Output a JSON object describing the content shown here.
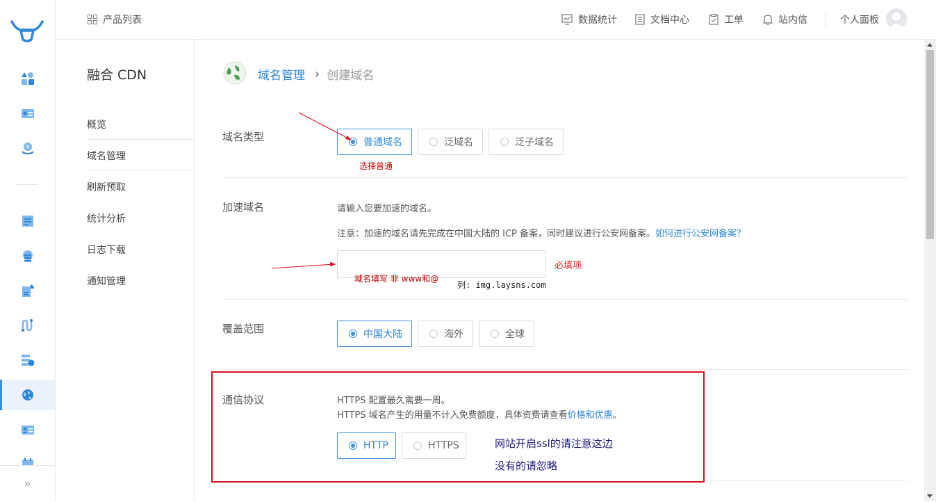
{
  "topbar": {
    "product_list": "产品列表",
    "stats": "数据统计",
    "docs": "文档中心",
    "ticket": "工单",
    "messages": "站内信",
    "panel": "个人面板"
  },
  "sidebar": {
    "title": "融合 CDN",
    "items": [
      "概览",
      "域名管理",
      "刷新预取",
      "统计分析",
      "日志下载",
      "通知管理"
    ]
  },
  "breadcrumb": {
    "parent": "域名管理",
    "separator": "›",
    "current": "创建域名"
  },
  "domain_type": {
    "label": "域名类型",
    "options": [
      "普通域名",
      "泛域名",
      "泛子域名"
    ],
    "selected": "普通域名",
    "annotation": "选择普通"
  },
  "accel_domain": {
    "label": "加速域名",
    "hint": "请输入您要加速的域名。",
    "notice": "注意：加速的域名请先完成在中国大陆的 ICP 备案，同时建议进行公安网备案。",
    "notice_link": "如何进行公安网备案？",
    "value": "",
    "required": "必填项",
    "annotation": "域名填写 非 www和@",
    "example": "列: img.laysns.com"
  },
  "coverage": {
    "label": "覆盖范围",
    "options": [
      "中国大陆",
      "海外",
      "全球"
    ],
    "selected": "中国大陆"
  },
  "protocol": {
    "label": "通信协议",
    "line1": "HTTPS 配置最久需要一周。",
    "line2_prefix": "HTTPS 域名产生的用量不计入免费额度，具体资费请查看",
    "line2_link": "价格和优惠",
    "line2_suffix": "。",
    "options": [
      "HTTP",
      "HTTPS"
    ],
    "selected": "HTTP",
    "annotation_1": "网站开启ssl的请注意这边",
    "annotation_2": "没有的请忽略"
  },
  "colors": {
    "accent": "#2d87d6",
    "annotation_red": "#d80f1c",
    "annotation_blue": "#1a1a80"
  }
}
